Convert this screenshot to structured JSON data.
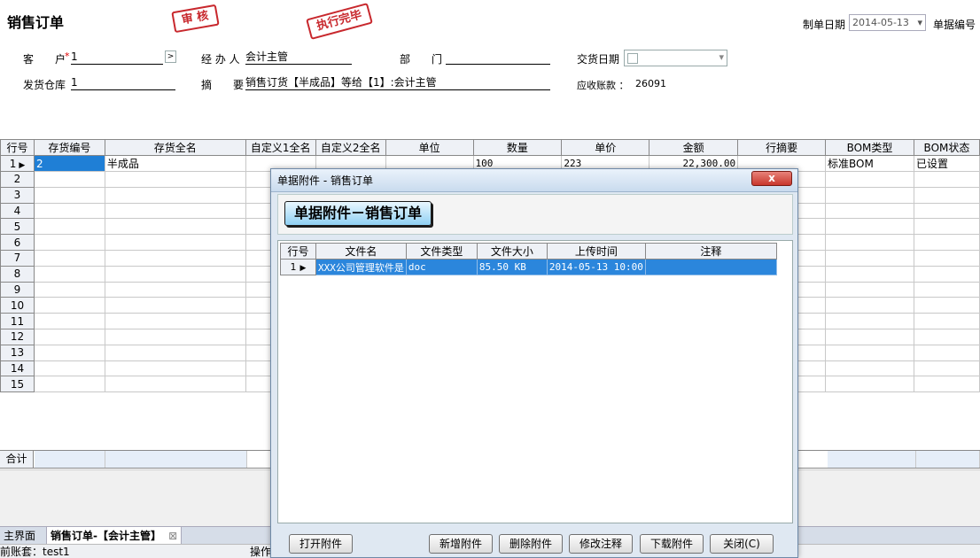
{
  "form": {
    "title": "销售订单",
    "stamp_audit": "审 核",
    "stamp_done": "执行完毕",
    "make_date_label": "制单日期",
    "make_date_value": "2014-05-13",
    "doc_no_label": "单据编号",
    "customer_label": "客　　户",
    "customer_value": "1",
    "handler_label": "经 办 人",
    "handler_value": "会计主管",
    "dept_label": "部　　门",
    "dept_value": "",
    "delivery_date_label": "交货日期",
    "warehouse_label": "发货仓库",
    "warehouse_value": "1",
    "summary_label": "摘　　要",
    "summary_value": "销售订货【半成品】等给【1】:会计主管",
    "receivable_label": "应收账款 ：",
    "receivable_value": "26091"
  },
  "grid": {
    "headers": [
      "行号",
      "存货编号",
      "存货全名",
      "自定义1全名",
      "自定义2全名",
      "单位",
      "数量",
      "单价",
      "金额",
      "行摘要",
      "BOM类型",
      "BOM状态"
    ],
    "rows": [
      [
        "1",
        "2",
        "半成品",
        "",
        "",
        "",
        "100",
        "223",
        "22,300.00",
        "",
        "标准BOM",
        "已设置"
      ],
      [
        "2",
        "",
        "",
        "",
        "",
        "",
        "",
        "",
        "",
        "",
        "",
        ""
      ],
      [
        "3",
        "",
        "",
        "",
        "",
        "",
        "",
        "",
        "",
        "",
        "",
        ""
      ],
      [
        "4",
        "",
        "",
        "",
        "",
        "",
        "",
        "",
        "",
        "",
        "",
        ""
      ],
      [
        "5",
        "",
        "",
        "",
        "",
        "",
        "",
        "",
        "",
        "",
        "",
        ""
      ],
      [
        "6",
        "",
        "",
        "",
        "",
        "",
        "",
        "",
        "",
        "",
        "",
        ""
      ],
      [
        "7",
        "",
        "",
        "",
        "",
        "",
        "",
        "",
        "",
        "",
        "",
        ""
      ],
      [
        "8",
        "",
        "",
        "",
        "",
        "",
        "",
        "",
        "",
        "",
        "",
        ""
      ],
      [
        "9",
        "",
        "",
        "",
        "",
        "",
        "",
        "",
        "",
        "",
        "",
        ""
      ],
      [
        "10",
        "",
        "",
        "",
        "",
        "",
        "",
        "",
        "",
        "",
        "",
        ""
      ],
      [
        "11",
        "",
        "",
        "",
        "",
        "",
        "",
        "",
        "",
        "",
        "",
        ""
      ],
      [
        "12",
        "",
        "",
        "",
        "",
        "",
        "",
        "",
        "",
        "",
        "",
        ""
      ],
      [
        "13",
        "",
        "",
        "",
        "",
        "",
        "",
        "",
        "",
        "",
        "",
        ""
      ],
      [
        "14",
        "",
        "",
        "",
        "",
        "",
        "",
        "",
        "",
        "",
        "",
        ""
      ],
      [
        "15",
        "",
        "",
        "",
        "",
        "",
        "",
        "",
        "",
        "",
        "",
        ""
      ]
    ],
    "total_label": "合计"
  },
  "tabs": {
    "home": "主界面",
    "current": "销售订单-【会计主管】"
  },
  "status": {
    "account": "前账套：test1",
    "operator": "操作"
  },
  "dialog": {
    "title": "单据附件 - 销售订单",
    "close": "x",
    "heading": "单据附件－销售订单",
    "headers": [
      "行号",
      "文件名",
      "文件类型",
      "文件大小",
      "上传时间",
      "注释"
    ],
    "rows": [
      [
        "1",
        "XXX公司管理软件是",
        "doc",
        "85.50 KB",
        "2014-05-13 10:00",
        ""
      ]
    ],
    "buttons": {
      "open": "打开附件",
      "add": "新增附件",
      "delete": "删除附件",
      "edit_note": "修改注释",
      "download": "下载附件",
      "close": "关闭(C)"
    }
  }
}
